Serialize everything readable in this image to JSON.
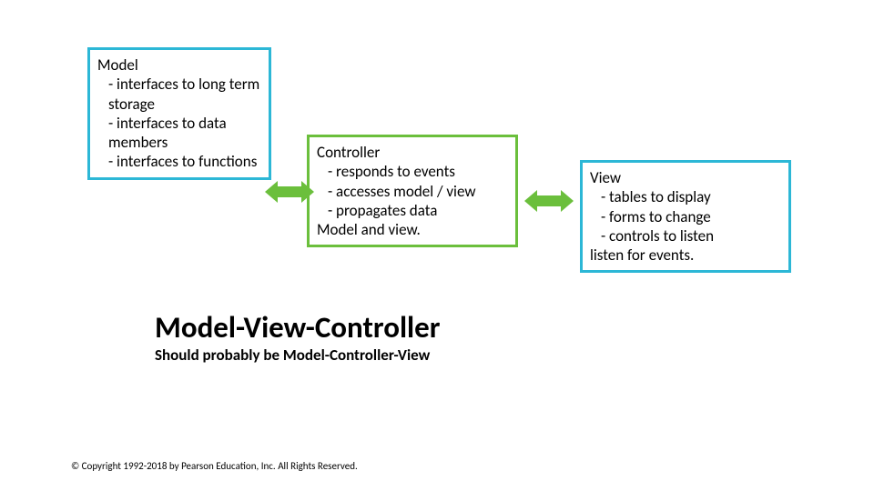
{
  "boxes": {
    "model": {
      "title": "Model",
      "items": [
        "- interfaces to long term storage",
        "- interfaces to data members",
        "- interfaces to functions"
      ]
    },
    "controller": {
      "title": "Controller",
      "items": [
        "- responds to events",
        "- accesses model / view",
        "- propagates data"
      ],
      "tail": "Model and view."
    },
    "view": {
      "title": "View",
      "items": [
        "- tables to display",
        "- forms to change",
        "- controls to listen"
      ],
      "tail": "listen for events."
    }
  },
  "heading": "Model-View-Controller",
  "subheading": "Should probably be Model-Controller-View",
  "copyright": "© Copyright 1992-2018 by Pearson Education, Inc. All Rights Reserved."
}
